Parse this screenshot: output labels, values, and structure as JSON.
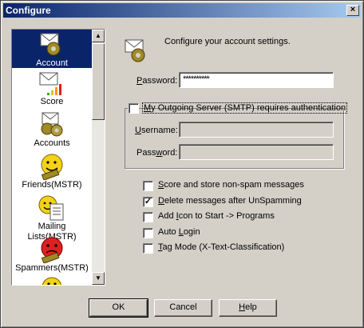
{
  "window": {
    "title": "Configure",
    "close_glyph": "×"
  },
  "sidebar": {
    "items": [
      {
        "label": "Account",
        "icon": "account-icon",
        "selected": true
      },
      {
        "label": "Score",
        "icon": "score-icon"
      },
      {
        "label": "Accounts",
        "icon": "accounts-icon"
      },
      {
        "label": "Friends(MSTR)",
        "icon": "friends-icon"
      },
      {
        "label": "Mailing Lists(MSTR)",
        "icon": "mailing-lists-icon"
      },
      {
        "label": "Spammers(MSTR)",
        "icon": "spammers-icon"
      },
      {
        "label": "",
        "icon": "partial-icon"
      }
    ],
    "scroll_up": "▲",
    "scroll_down": "▼"
  },
  "main": {
    "header_text": "Configure your account settings.",
    "password": {
      "label_u": "P",
      "label_rest": "assword:",
      "value": "**********"
    },
    "smtp_auth": {
      "checked": false,
      "label_pre": "",
      "label_u": "M",
      "label_rest": "y Outgoing Server (SMTP) requires authentication"
    },
    "username": {
      "label_u": "U",
      "label_rest": "sername:",
      "value": ""
    },
    "smtp_password": {
      "label_pre": "Pass",
      "label_u": "w",
      "label_rest": "ord:",
      "value": ""
    },
    "options": [
      {
        "checked": false,
        "label_pre": "",
        "label_u": "S",
        "label_rest": "core and store non-spam messages"
      },
      {
        "checked": true,
        "label_pre": "",
        "label_u": "D",
        "label_rest": "elete messages after UnSpamming"
      },
      {
        "checked": false,
        "label_pre": "Add ",
        "label_u": "I",
        "label_rest": "con to Start -> Programs"
      },
      {
        "checked": false,
        "label_pre": "Auto ",
        "label_u": "L",
        "label_rest": "ogin"
      },
      {
        "checked": false,
        "label_pre": "",
        "label_u": "T",
        "label_rest": "ag Mode (X-Text-Classification)"
      }
    ],
    "check_glyph": "✓"
  },
  "buttons": {
    "ok": "OK",
    "cancel": "Cancel",
    "help_u": "H",
    "help_rest": "elp"
  }
}
